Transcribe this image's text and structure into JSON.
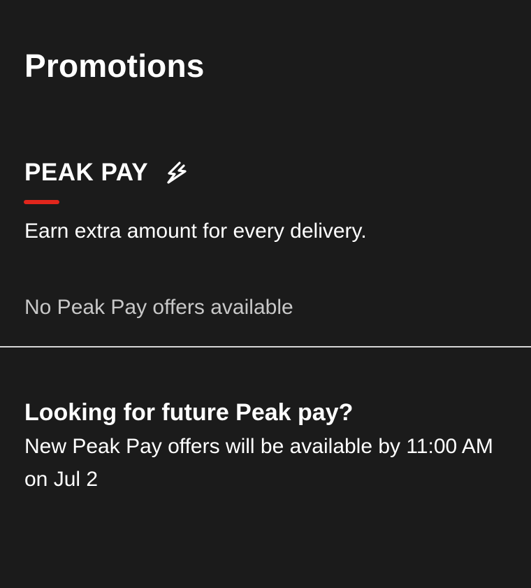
{
  "page": {
    "title": "Promotions"
  },
  "peak_pay": {
    "title": "PEAK PAY",
    "icon": "lightning-bolt-icon",
    "description": "Earn extra amount for every delivery.",
    "empty_message": "No Peak Pay offers available"
  },
  "future": {
    "title": "Looking for future Peak pay?",
    "message": "New Peak Pay offers will be available by 11:00 AM on Jul 2"
  },
  "colors": {
    "background": "#1b1b1b",
    "accent": "#e1261c",
    "text": "#ffffff",
    "muted_text": "#c8c8c8",
    "divider": "#d6d6d6"
  }
}
